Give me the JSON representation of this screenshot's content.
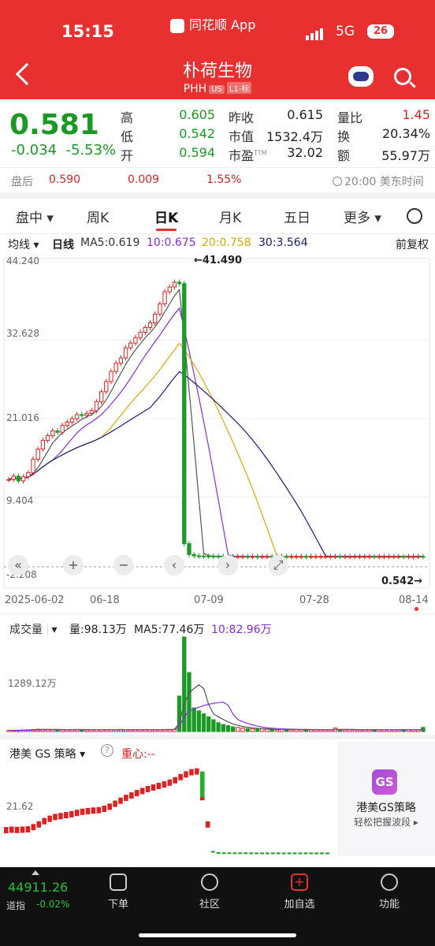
{
  "status_bar": {
    "time": "15:15",
    "app_name": "同花顺 App",
    "network": "5G",
    "battery": "26"
  },
  "stock": {
    "name": "朴荷生物",
    "code": "PHH",
    "tag_market": "US",
    "tag_level": "L1-标"
  },
  "quote": {
    "price": "0.581",
    "change": "-0.034",
    "change_pct": "-5.53%",
    "high_label": "高",
    "high": "0.605",
    "low_label": "低",
    "low": "0.542",
    "open_label": "开",
    "open": "0.594",
    "prev_close_label": "昨收",
    "prev_close": "0.615",
    "mkt_cap_label": "市值",
    "mkt_cap": "1532.4万",
    "pe_label": "市盈",
    "pe_sup": "TTM",
    "pe": "32.02",
    "vol_ratio_label": "量比",
    "vol_ratio": "1.45",
    "turnover_label": "换",
    "turnover": "20.34%",
    "amount_label": "额",
    "amount": "55.97万"
  },
  "after_hours": {
    "label": "盘后",
    "price": "0.590",
    "change": "0.009",
    "change_pct": "1.55%",
    "time": "20:00 美东时间"
  },
  "tabs": [
    "盘中",
    "周K",
    "日K",
    "月K",
    "五日",
    "更多"
  ],
  "active_tab": "日K",
  "ma_legend": {
    "type": "均线",
    "period": "日线",
    "ma5": "MA5:0.619",
    "ma10": "10:0.675",
    "ma20": "20:0.758",
    "ma30": "30:3.564",
    "adjust": "前复权"
  },
  "price_axis": [
    "44.240",
    "32.628",
    "21.016",
    "9.404",
    "-2.208"
  ],
  "peak_label": "←41.490",
  "last_label": "0.542→",
  "date_axis": [
    "2025-06-02",
    "06-18",
    "07-09",
    "07-28",
    "08-14"
  ],
  "volume_legend": {
    "label": "成交量",
    "vol": "量:98.13万",
    "ma5": "MA5:77.46万",
    "ma10": "10:82.96万",
    "axis": "1289.12万"
  },
  "strategy": {
    "label": "港美 GS 策略",
    "focus": "重心:--",
    "axis": "21.62",
    "promo_title": "港美GS策略",
    "promo_sub": "轻松把握波段 ▸",
    "logo": "GS"
  },
  "bottom_nav": {
    "index_value": "44911.26",
    "index_name": "道指",
    "index_change": "-0.02%",
    "items": [
      "下单",
      "社区",
      "加自选",
      "功能"
    ]
  },
  "colors": {
    "up": "#e02020",
    "down": "#1a9a25",
    "ma5": "#555555",
    "ma10": "#8a2be2",
    "ma20": "#e0a800",
    "ma30": "#1a1a7a",
    "header": "#e93030"
  },
  "chart_data": {
    "type": "candlestick",
    "ylim": [
      -2.208,
      44.24
    ],
    "x_start": "2025-06-02",
    "x_end": "08-14",
    "peak": 41.49,
    "last": 0.542,
    "closes": [
      12.0,
      12.5,
      11.8,
      12.4,
      13.0,
      15.0,
      16.5,
      17.8,
      18.5,
      19.2,
      19.0,
      20.0,
      20.5,
      21.0,
      21.6,
      21.5,
      21.8,
      22.2,
      23.5,
      25.0,
      26.5,
      28.0,
      29.2,
      30.0,
      31.5,
      32.2,
      33.0,
      33.8,
      34.5,
      35.2,
      36.5,
      38.0,
      39.8,
      40.5,
      41.2,
      41.0,
      2.5,
      0.9,
      0.7,
      0.68,
      0.66,
      0.65,
      0.64,
      0.63,
      0.62,
      0.61,
      0.6,
      0.6,
      0.6,
      0.59,
      0.6,
      0.59,
      0.6,
      0.6,
      0.59,
      0.6,
      0.6,
      0.59,
      0.6,
      0.6,
      0.6,
      0.59,
      0.6,
      0.6,
      0.6,
      0.6,
      0.6,
      0.61,
      0.6,
      0.6,
      0.6,
      0.6,
      0.6,
      0.6,
      0.6,
      0.59,
      0.6,
      0.6,
      0.6,
      0.6,
      0.6,
      0.59,
      0.6,
      0.6,
      0.6,
      0.58
    ],
    "volume_ylim": [
      0,
      1600
    ],
    "volumes": [
      20,
      18,
      22,
      25,
      30,
      35,
      40,
      38,
      36,
      34,
      30,
      28,
      30,
      32,
      35,
      30,
      28,
      30,
      32,
      34,
      30,
      32,
      34,
      36,
      30,
      28,
      30,
      32,
      35,
      34,
      30,
      32,
      34,
      36,
      40,
      600,
      1600,
      1000,
      400,
      350,
      300,
      250,
      200,
      150,
      120,
      100,
      80,
      70,
      60,
      50,
      50,
      40,
      45,
      40,
      35,
      30,
      40,
      35,
      30,
      35,
      30,
      35,
      30,
      30,
      28,
      30,
      32,
      60,
      30,
      28,
      30,
      28,
      26,
      28,
      30,
      32,
      30,
      28,
      26,
      28,
      30,
      35,
      32,
      30,
      28,
      70
    ]
  }
}
